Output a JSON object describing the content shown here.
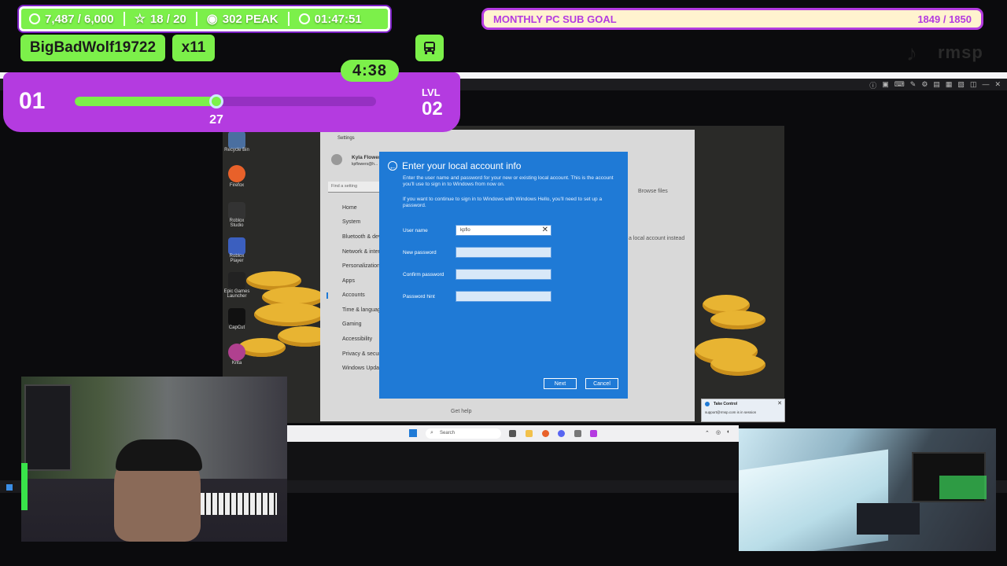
{
  "overlay": {
    "stats": {
      "followers": "7,487 / 6,000",
      "stars": "18 / 20",
      "viewers": "302 PEAK",
      "uptime": "01:47:51"
    },
    "user_name": "BigBadWolf19722",
    "multiplier": "x11",
    "timer": "4:38",
    "level_current": "01",
    "level_label": "LVL",
    "level_next": "02",
    "xp_value": "27",
    "xp_progress": 0.47,
    "goal": {
      "label": "MONTHLY PC SUB GOAL",
      "value": "1849 / 1850"
    },
    "brand": "rmsp",
    "colors": {
      "accent_green": "#7cf04a",
      "accent_purple": "#b43be0",
      "dialog_blue": "#1f7ad6"
    }
  },
  "settings_window": {
    "app_title": "Settings",
    "user_display": "Kyla Flowers",
    "user_email": "kpflowers@h...",
    "search_placeholder": "Find a setting",
    "nav": [
      "Home",
      "System",
      "Bluetooth & dev",
      "Network & inter",
      "Personalization",
      "Apps",
      "Accounts",
      "Time & language",
      "Gaming",
      "Accessibility",
      "Privacy & securi",
      "Windows Update"
    ],
    "browse_files": "Browse files",
    "local_account_link": "a local account instead",
    "get_help": "Get help"
  },
  "dialog": {
    "title": "Enter your local account info",
    "desc1": "Enter the user name and password for your new or existing local account. This is the account you'll use to sign in to Windows from now on.",
    "desc2": "If you want to continue to sign in to Windows with Windows Hello, you'll need to set up a password.",
    "fields": {
      "username_label": "User name",
      "username_value": "kpflo",
      "new_password_label": "New password",
      "confirm_password_label": "Confirm password",
      "hint_label": "Password hint"
    },
    "next_label": "Next",
    "cancel_label": "Cancel"
  },
  "desktop_icons": [
    "Recycle Bin",
    "Firefox",
    "Roblox Studio",
    "Roblox Player",
    "Epic Games Launcher",
    "CapCut",
    "Krita"
  ],
  "toast": {
    "title": "Take Control",
    "body": "support@rmsp.com is in session"
  },
  "taskbar": {
    "search_placeholder": "Search"
  }
}
